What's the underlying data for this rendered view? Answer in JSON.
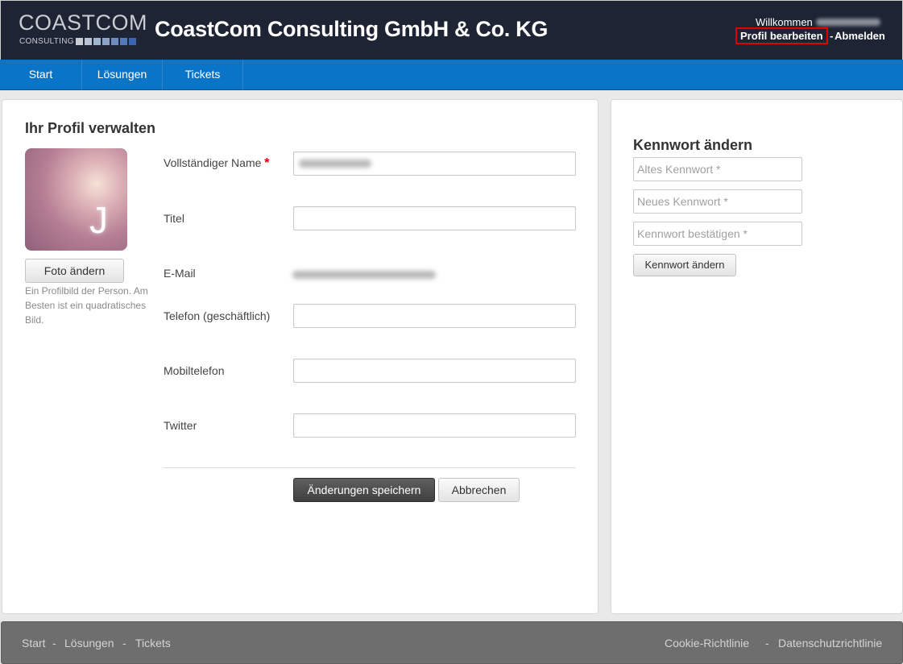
{
  "header": {
    "logo_main": "COASTCOM",
    "logo_sub": "CONSULTING",
    "company_name": "CoastCom Consulting GmbH & Co. KG",
    "welcome_text": "Willkommen",
    "profile_edit_label": "Profil bearbeiten",
    "separator": "-",
    "logout_label": "Abmelden"
  },
  "nav": {
    "items": [
      {
        "label": "Start"
      },
      {
        "label": "Lösungen"
      },
      {
        "label": "Tickets"
      }
    ]
  },
  "profile": {
    "title": "Ihr Profil verwalten",
    "avatar_letter": "J",
    "change_photo_label": "Foto ändern",
    "photo_help": "Ein Profilbild der Person. Am Besten ist ein quadratisches Bild.",
    "required_mark": "*",
    "fields": {
      "full_name_label": "Vollständiger Name",
      "title_label": "Titel",
      "email_label": "E-Mail",
      "phone_label": "Telefon (geschäftlich)",
      "mobile_label": "Mobiltelefon",
      "twitter_label": "Twitter"
    },
    "save_label": "Änderungen speichern",
    "cancel_label": "Abbrechen"
  },
  "password": {
    "title": "Kennwort ändern",
    "old_placeholder": "Altes Kennwort *",
    "new_placeholder": "Neues Kennwort *",
    "confirm_placeholder": "Kennwort bestätigen *",
    "submit_label": "Kennwort ändern"
  },
  "footer": {
    "links": [
      {
        "label": "Start"
      },
      {
        "label": "Lösungen"
      },
      {
        "label": "Tickets"
      }
    ],
    "separator": "-",
    "cookie_label": "Cookie-Richtlinie",
    "privacy_label": "Datenschutzrichtlinie"
  },
  "colors": {
    "header_bg": "#1e2433",
    "nav_bg": "#0a74c8",
    "highlight_border": "#e00000",
    "footer_bg": "#6e6e6e"
  }
}
